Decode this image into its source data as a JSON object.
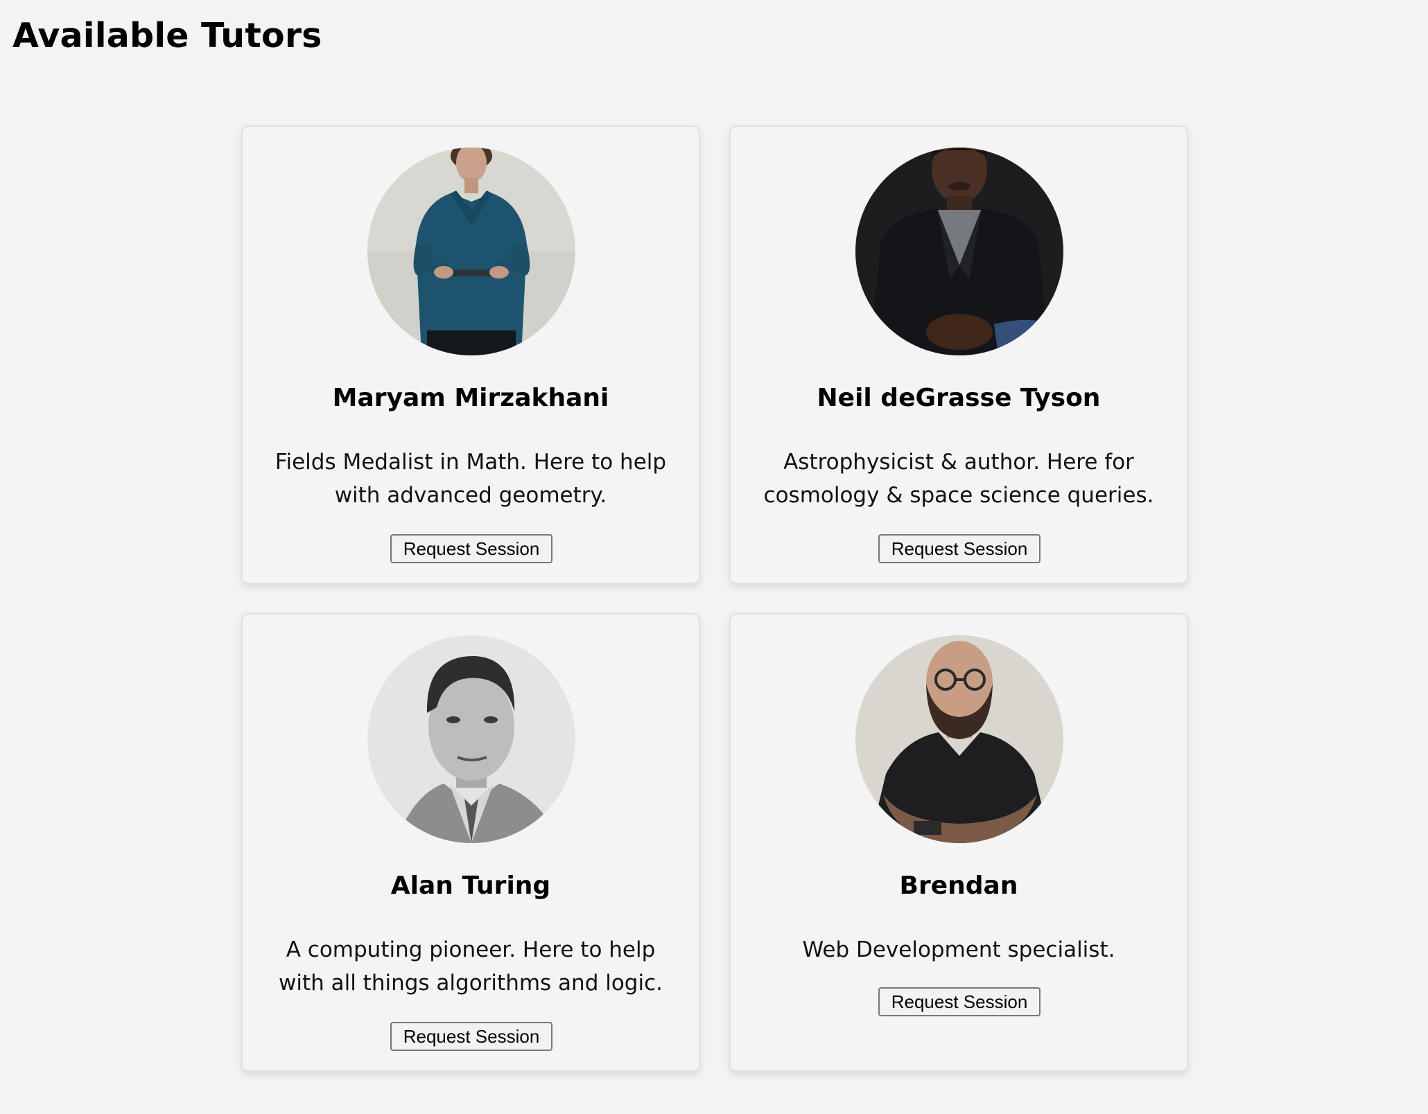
{
  "page": {
    "title": "Available Tutors"
  },
  "tutors": [
    {
      "name": "Maryam Mirzakhani",
      "bio": "Fields Medalist in Math. Here to help with advanced geometry.",
      "button_label": "Request Session"
    },
    {
      "name": "Neil deGrasse Tyson",
      "bio": "Astrophysicist & author. Here for cosmology & space science queries.",
      "button_label": "Request Session"
    },
    {
      "name": "Alan Turing",
      "bio": "A computing pioneer. Here to help with all things algorithms and logic.",
      "button_label": "Request Session"
    },
    {
      "name": "Brendan",
      "bio": "Web Development specialist.",
      "button_label": "Request Session"
    }
  ],
  "colors": {
    "page_background": "#f3f3f3",
    "card_background": "#f4f4f4",
    "card_border": "#e1e1e1",
    "button_border": "#777777"
  }
}
